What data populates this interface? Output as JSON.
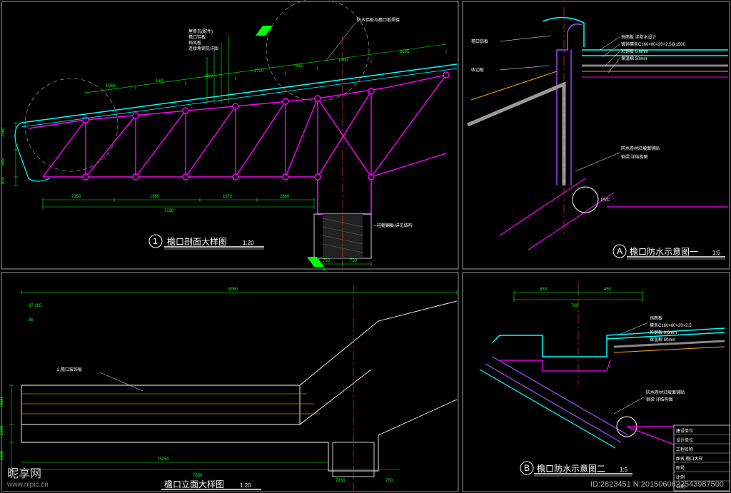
{
  "drawings": {
    "view1": {
      "tag": "1",
      "title": "檐口剖面大样图",
      "scale": "1:20"
    },
    "view2": {
      "tag": "A",
      "title": "檐口防水示意图一",
      "scale": "1:5"
    },
    "view3": {
      "title": "檐口立面大样图",
      "scale": "1:20"
    },
    "view4": {
      "tag": "B",
      "title": "檐口防水示意图二",
      "scale": "1:5"
    }
  },
  "dimensions_v1": {
    "top": [
      "1060",
      "160",
      "850",
      "1720",
      "935",
      "1800",
      "2195"
    ],
    "left_v": [
      "2560",
      "685",
      "800"
    ],
    "bottom_row1": [
      "2356",
      "1850",
      "1972",
      "2880"
    ],
    "bottom_total": "7230",
    "col_bottom": [
      "750",
      "750"
    ],
    "arrow_a_bottom": "A"
  },
  "dimensions_v3": {
    "top_overall": "9050",
    "left_top": "87 265",
    "left_below": "85",
    "left_v": [
      "2680",
      "1800",
      "1600"
    ],
    "bottom_row1": [
      "75250",
      "7230",
      "750"
    ],
    "bottom_total": "7550"
  },
  "dimensions_v4": {
    "top": [
      "450",
      "450"
    ],
    "top_total": "700"
  },
  "labels_v1": {
    "upper_left_arrow": "A",
    "notes_center": [
      "屋脊瓦(配件)",
      "檐口铝板",
      "挡风板",
      "连接角钢见详图",
      "防水铝板与檐口板焊接"
    ],
    "right_col_note": "柱帽钢板,详见结构"
  },
  "labels_v2": {
    "left_notes": [
      "檐口铝板",
      "收边板"
    ],
    "right_notes": [
      "挡雨板 详防水设计",
      "镀锌檩条C160×60×20×2.5@1500",
      "彩钢板 0.6mm",
      "保温棉 50mm"
    ],
    "lower_right": [
      "防水卷材沿坡面铺贴",
      "钢梁 详结构图"
    ],
    "pipe": "PVC"
  },
  "labels_v3": {
    "left_note": "2,檐口装饰板"
  },
  "labels_v4": {
    "right_notes": [
      "挡雨板",
      "檩条C160×60×20×2.5",
      "彩钢板 0.6mm",
      "保温棉 50mm"
    ],
    "lower_right": [
      "防水卷材沿坡面铺贴",
      "钢梁 详结构图"
    ]
  },
  "title_block": {
    "rows": [
      "建设单位",
      "设计单位",
      "工程名称",
      "图名  檐口大样",
      "图号",
      "比例",
      "日期"
    ]
  },
  "footer": {
    "site": "昵享网",
    "url": "www.nipic.cn",
    "id": "ID:2823451 N:2015060622543987500"
  }
}
